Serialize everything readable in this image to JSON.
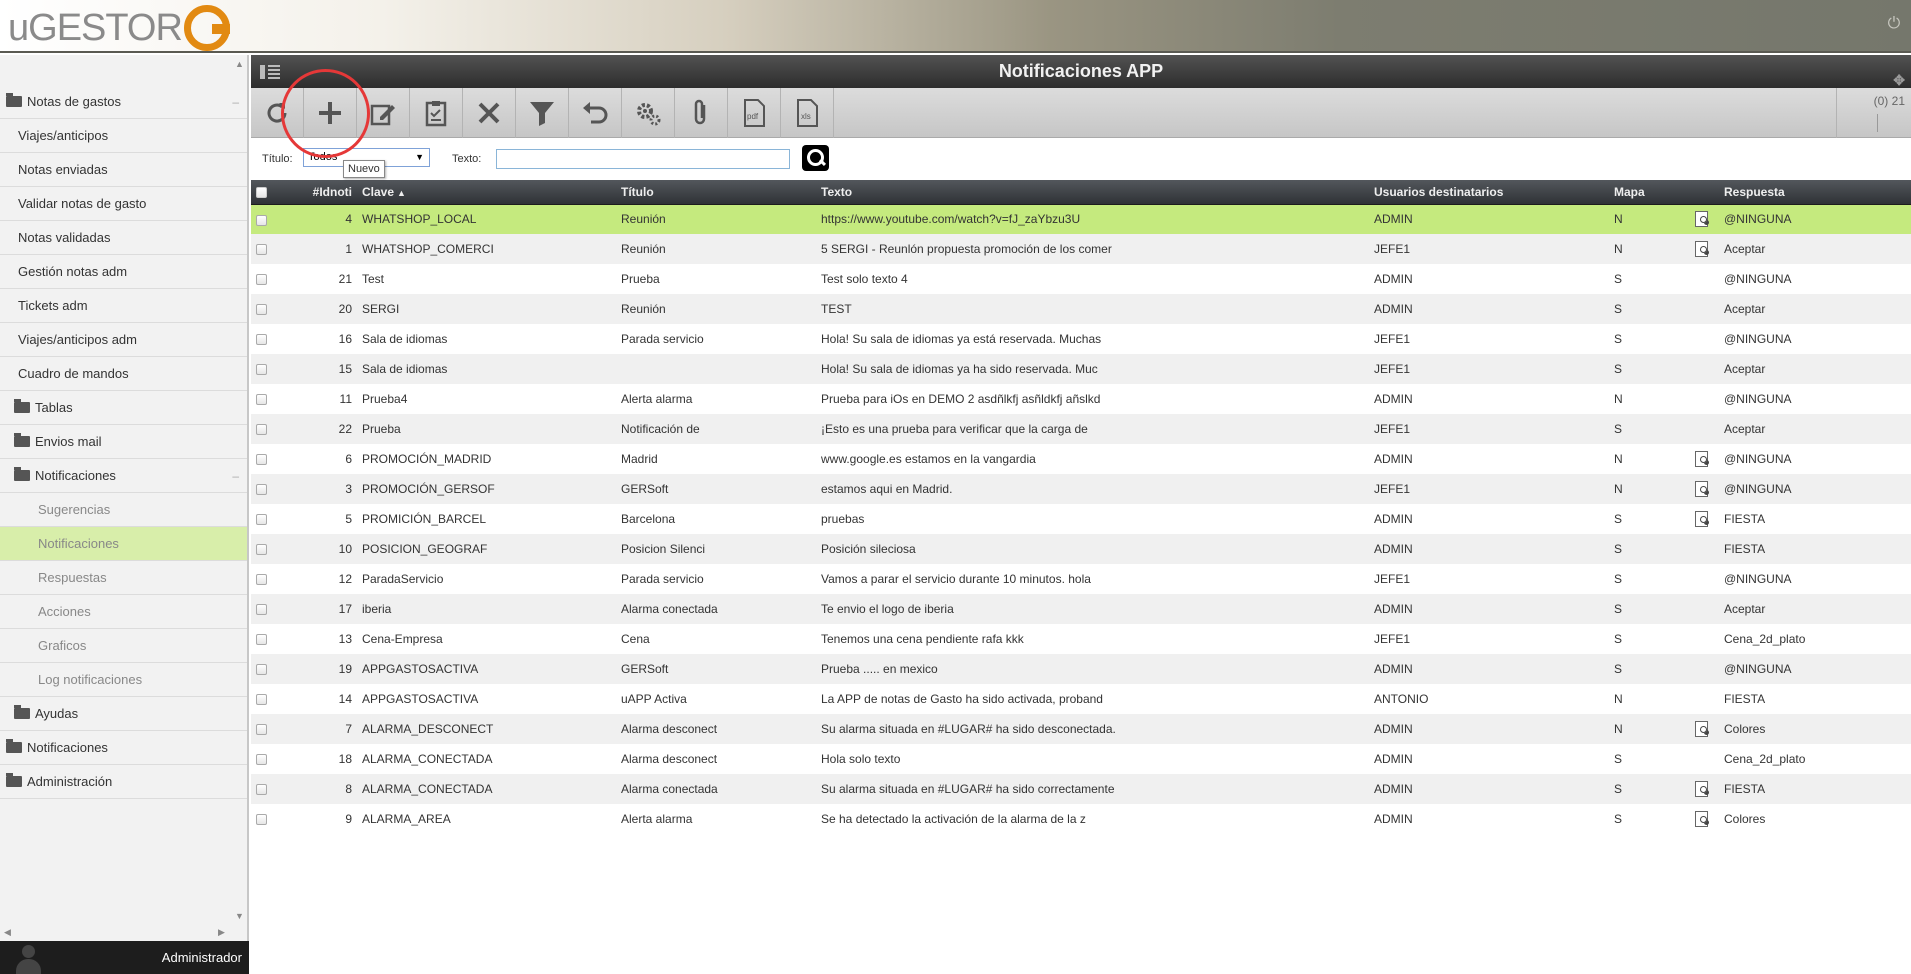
{
  "app": {
    "logo_text": "uGESTOR",
    "title": "Notificaciones APP"
  },
  "sidebar": {
    "items": [
      {
        "label": "Notas de gastos",
        "level": 0,
        "folder": true,
        "collapse": "–"
      },
      {
        "label": "Viajes/anticipos",
        "level": 1
      },
      {
        "label": "Notas enviadas",
        "level": 1
      },
      {
        "label": "Validar notas de gasto",
        "level": 1
      },
      {
        "label": "Notas validadas",
        "level": 1
      },
      {
        "label": "Gestión notas adm",
        "level": 1
      },
      {
        "label": "Tickets adm",
        "level": 1
      },
      {
        "label": "Viajes/anticipos adm",
        "level": 1
      },
      {
        "label": "Cuadro de mandos",
        "level": 1
      },
      {
        "label": "Tablas",
        "level": 1,
        "folder": true
      },
      {
        "label": "Envios mail",
        "level": 1,
        "folder": true
      },
      {
        "label": "Notificaciones",
        "level": 1,
        "folder": true,
        "collapse": "–"
      },
      {
        "label": "Sugerencias",
        "level": 2
      },
      {
        "label": "Notificaciones",
        "level": 2,
        "active": true
      },
      {
        "label": "Respuestas",
        "level": 2
      },
      {
        "label": "Acciones",
        "level": 2
      },
      {
        "label": "Graficos",
        "level": 2
      },
      {
        "label": "Log notificaciones",
        "level": 2
      },
      {
        "label": "Ayudas",
        "level": 1,
        "folder": true
      },
      {
        "label": "Notificaciones",
        "level": 0,
        "folder": true
      },
      {
        "label": "Administración",
        "level": 0,
        "folder": true
      }
    ],
    "user": "Administrador"
  },
  "toolbar": {
    "buttons": [
      {
        "name": "refresh-icon"
      },
      {
        "name": "add-icon"
      },
      {
        "name": "edit-icon"
      },
      {
        "name": "clipboard-icon"
      },
      {
        "name": "delete-icon"
      },
      {
        "name": "filter-icon"
      },
      {
        "name": "undo-icon"
      },
      {
        "name": "settings-icon"
      },
      {
        "name": "attach-icon"
      },
      {
        "name": "pdf-icon",
        "label": "pdf"
      },
      {
        "name": "xls-icon",
        "label": "xls"
      }
    ],
    "count": "(0) 21",
    "tooltip": "Nuevo"
  },
  "filters": {
    "titulo_label": "Título:",
    "titulo_value": "Todos",
    "texto_label": "Texto:",
    "texto_value": ""
  },
  "table": {
    "columns": [
      "#Idnoti",
      "Clave",
      "Título",
      "Texto",
      "Usuarios destinatarios",
      "Mapa",
      "Respuesta"
    ],
    "rows": [
      {
        "id": "4",
        "clave": "WHATSHOP_LOCAL",
        "titulo": "Reunión",
        "texto": "https://www.youtube.com/watch?v=fJ_zaYbzu3U",
        "usuarios": "ADMIN",
        "mapa": "N",
        "icon": true,
        "respuesta": "@NINGUNA"
      },
      {
        "id": "1",
        "clave": "WHATSHOP_COMERCI",
        "titulo": "Reunión",
        "texto": "5 SERGI - Reunlón propuesta promoción de los comer",
        "usuarios": "JEFE1",
        "mapa": "N",
        "icon": true,
        "respuesta": "Aceptar"
      },
      {
        "id": "21",
        "clave": "Test",
        "titulo": "Prueba",
        "texto": "Test solo texto 4",
        "usuarios": "ADMIN",
        "mapa": "S",
        "icon": false,
        "respuesta": "@NINGUNA"
      },
      {
        "id": "20",
        "clave": "SERGI",
        "titulo": "Reunión",
        "texto": "TEST",
        "usuarios": "ADMIN",
        "mapa": "S",
        "icon": false,
        "respuesta": "Aceptar"
      },
      {
        "id": "16",
        "clave": "Sala de idiomas",
        "titulo": "Parada servicio",
        "texto": "Hola! Su sala de idiomas ya está reservada. Muchas",
        "usuarios": "JEFE1",
        "mapa": "S",
        "icon": false,
        "respuesta": "@NINGUNA"
      },
      {
        "id": "15",
        "clave": "Sala de idiomas",
        "titulo": "",
        "texto": "Hola! Su sala de idiomas ya ha sido reservada. Muc",
        "usuarios": "JEFE1",
        "mapa": "S",
        "icon": false,
        "respuesta": "Aceptar"
      },
      {
        "id": "11",
        "clave": "Prueba4",
        "titulo": "Alerta alarma",
        "texto": "Prueba para iOs en DEMO 2 asdñlkfj asñldkfj añslkd",
        "usuarios": "ADMIN",
        "mapa": "N",
        "icon": false,
        "respuesta": "@NINGUNA"
      },
      {
        "id": "22",
        "clave": "Prueba",
        "titulo": "Notificación de",
        "texto": "¡Esto es una prueba para verificar que la carga de",
        "usuarios": "JEFE1",
        "mapa": "S",
        "icon": false,
        "respuesta": "Aceptar"
      },
      {
        "id": "6",
        "clave": "PROMOCIÓN_MADRID",
        "titulo": "Madrid",
        "texto": "www.google.es estamos en la vangardia",
        "usuarios": "ADMIN",
        "mapa": "N",
        "icon": true,
        "respuesta": "@NINGUNA"
      },
      {
        "id": "3",
        "clave": "PROMOCIÓN_GERSOF",
        "titulo": "GERSoft",
        "texto": "estamos aqui en Madrid.",
        "usuarios": "JEFE1",
        "mapa": "N",
        "icon": true,
        "respuesta": "@NINGUNA"
      },
      {
        "id": "5",
        "clave": "PROMICIÓN_BARCEL",
        "titulo": "Barcelona",
        "texto": "pruebas",
        "usuarios": "ADMIN",
        "mapa": "S",
        "icon": true,
        "respuesta": "FIESTA"
      },
      {
        "id": "10",
        "clave": "POSICION_GEOGRAF",
        "titulo": "Posicion Silenci",
        "texto": "Posición sileciosa",
        "usuarios": "ADMIN",
        "mapa": "S",
        "icon": false,
        "respuesta": "FIESTA"
      },
      {
        "id": "12",
        "clave": "ParadaServicio",
        "titulo": "Parada servicio",
        "texto": "Vamos a parar el servicio durante 10 minutos. hola",
        "usuarios": "JEFE1",
        "mapa": "S",
        "icon": false,
        "respuesta": "@NINGUNA"
      },
      {
        "id": "17",
        "clave": "iberia",
        "titulo": "Alarma conectada",
        "texto": "Te envio el logo de iberia",
        "usuarios": "ADMIN",
        "mapa": "S",
        "icon": false,
        "respuesta": "Aceptar"
      },
      {
        "id": "13",
        "clave": "Cena-Empresa",
        "titulo": "Cena",
        "texto": "Tenemos una cena pendiente rafa kkk",
        "usuarios": "JEFE1",
        "mapa": "S",
        "icon": false,
        "respuesta": "Cena_2d_plato"
      },
      {
        "id": "19",
        "clave": "APPGASTOSACTIVA",
        "titulo": "GERSoft",
        "texto": "Prueba ..... en mexico",
        "usuarios": "ADMIN",
        "mapa": "S",
        "icon": false,
        "respuesta": "@NINGUNA"
      },
      {
        "id": "14",
        "clave": "APPGASTOSACTIVA",
        "titulo": "uAPP Activa",
        "texto": "La APP de notas de Gasto ha sido activada, proband",
        "usuarios": "ANTONIO",
        "mapa": "N",
        "icon": false,
        "respuesta": "FIESTA"
      },
      {
        "id": "7",
        "clave": "ALARMA_DESCONECT",
        "titulo": "Alarma desconect",
        "texto": "Su alarma situada en #LUGAR# ha sido desconectada.",
        "usuarios": "ADMIN",
        "mapa": "N",
        "icon": true,
        "respuesta": "Colores"
      },
      {
        "id": "18",
        "clave": "ALARMA_CONECTADA",
        "titulo": "Alarma desconect",
        "texto": "Hola solo texto",
        "usuarios": "ADMIN",
        "mapa": "S",
        "icon": false,
        "respuesta": "Cena_2d_plato"
      },
      {
        "id": "8",
        "clave": "ALARMA_CONECTADA",
        "titulo": "Alarma conectada",
        "texto": "Su alarma situada en #LUGAR# ha sido correctamente",
        "usuarios": "ADMIN",
        "mapa": "S",
        "icon": true,
        "respuesta": "FIESTA"
      },
      {
        "id": "9",
        "clave": "ALARMA_AREA",
        "titulo": "Alerta alarma",
        "texto": "Se ha detectado la activación de la alarma de la z",
        "usuarios": "ADMIN",
        "mapa": "S",
        "icon": true,
        "respuesta": "Colores"
      }
    ]
  }
}
